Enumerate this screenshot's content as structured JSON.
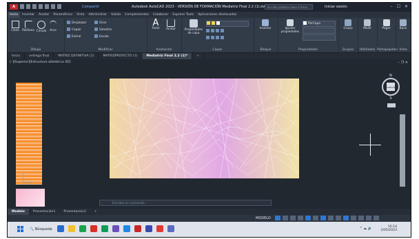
{
  "window": {
    "app_badge": "A",
    "share_label": "Compartir",
    "title": "Autodesk AutoCAD 2023 - VERSIÓN DE FORMACIÓN   Mediatriz Final 2.2 (1).dwg",
    "search_placeholder": "Escriba palabra clave o frase",
    "signin_label": "Iniciar sesión",
    "controls": [
      "–",
      "☐",
      "✕"
    ]
  },
  "ribbon_tabs": [
    "Inicio",
    "Insertar",
    "Anotar",
    "Paramétrico",
    "Vista",
    "Administrar",
    "Salida",
    "Complementos",
    "Colaborar",
    "Express Tools",
    "Aplicaciones destacadas"
  ],
  "ribbon_active_tab": "Inicio",
  "ribbon": {
    "draw": {
      "title": "Dibujo",
      "tools": [
        "Línea",
        "Polilínea",
        "Círculo",
        "Arco"
      ]
    },
    "modify": {
      "title": "Modificar",
      "items": [
        "Desplazar",
        "Girar",
        "Copiar",
        "Simetría",
        "Estirar",
        "Escala"
      ]
    },
    "annotation": {
      "title": "Anotación",
      "tools": [
        "Texto",
        "Acotar"
      ]
    },
    "layers": {
      "title": "Capas",
      "props_label": "Propiedades de capa"
    },
    "block": {
      "title": "Bloque",
      "insert_label": "Insertar"
    },
    "properties": {
      "title": "Propiedades",
      "match_label": "Igualar propiedades",
      "layer_value": "PorCapa"
    },
    "groups": {
      "title": "Grupos",
      "label": "Grupo"
    },
    "utilities": {
      "title": "Utilidades",
      "label": "Medir"
    },
    "clipboard": {
      "title": "Portapapeles",
      "label": "Pegar"
    },
    "view": {
      "title": "Vista",
      "label": "Base"
    }
  },
  "file_tabs": [
    "Inicio",
    "entrega final",
    "MATRIZ DEFINITIVA (1)",
    "MATRIZPROYECTO (1)",
    "Mediatriz Final 2.2 (1)*"
  ],
  "file_tab_active": "Mediatriz Final 2.2 (1)*",
  "viewport": {
    "label": "[–][Superior][Estructura alámbrica 2D]",
    "controls": "– ❐ ✕",
    "viewcube_top": "N",
    "viewcube_bottom": "S",
    "viewcube_center": "SUPERIOR",
    "wcs_label": "SCU"
  },
  "command_line": {
    "placeholder": "Escriba un comando"
  },
  "layout_tabs": [
    "Modelo",
    "Presentación1",
    "Presentación2",
    "+"
  ],
  "layout_active": "Modelo",
  "status": {
    "model_label": "MODELO"
  },
  "taskbar": {
    "search_label": "Búsqueda",
    "time": "10:14",
    "date": "2/05/2023",
    "app_colors": [
      "#2a6bd1",
      "#f2c12e",
      "#1aa34a",
      "#d93025",
      "#0f9d58",
      "#6b4fbb",
      "#1e88e5",
      "#c62828",
      "#3949ab",
      "#e53935",
      "#5c6bc0"
    ]
  },
  "colors": {
    "ribbon_bg": "#323b48",
    "title_bg": "#1f2530",
    "viewport_bg": "#212830",
    "accent": "#2f77d0",
    "autocad_red": "#c4262e"
  }
}
